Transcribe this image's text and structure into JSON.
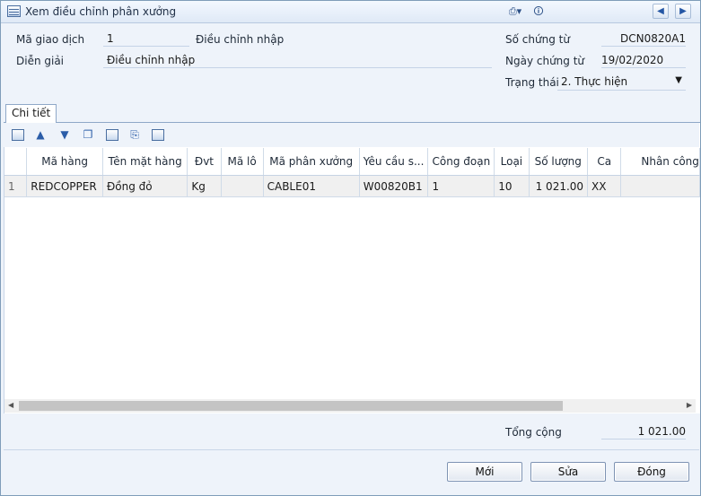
{
  "window": {
    "title": "Xem điều chỉnh phân xưởng"
  },
  "titlebar": {
    "print_glyph": "⎙▾",
    "info_glyph": "🛈",
    "prev_glyph": "◆",
    "next_glyph": "◆"
  },
  "form": {
    "ma_giao_dich_label": "Mã giao dịch",
    "ma_giao_dich_value": "1",
    "loai_value": "Điều chỉnh nhập",
    "dien_giai_label": "Diễn giải",
    "dien_giai_value": "Điều chỉnh nhập",
    "so_chung_tu_label": "Số chứng từ",
    "so_chung_tu_value": "DCN0820A1",
    "ngay_chung_tu_label": "Ngày chứng từ",
    "ngay_chung_tu_value": "19/02/2020",
    "trang_thai_label": "Trạng thái",
    "trang_thai_value": "2. Thực hiện"
  },
  "tabs": [
    {
      "label": "Chi tiết"
    }
  ],
  "grid": {
    "columns": [
      "",
      "Mã hàng",
      "Tên mặt hàng",
      "Đvt",
      "Mã lô",
      "Mã phân xưởng",
      "Yêu cầu s...",
      "Công đoạn",
      "Loại",
      "Số lượng",
      "Ca",
      "Nhân công"
    ],
    "rows": [
      [
        "1",
        "REDCOPPER",
        "Đồng đỏ",
        "Kg",
        "",
        "CABLE01",
        "W00820B1",
        "1",
        "10",
        "1 021.00",
        "XX",
        ""
      ]
    ]
  },
  "totals": {
    "label": "Tổng cộng",
    "value": "1 021.00"
  },
  "buttons": {
    "new": "Mới",
    "edit": "Sửa",
    "close": "Đóng"
  },
  "colors": {
    "background": "#eef3fa",
    "border": "#7f9db9",
    "selected_row": "#f0f0f0"
  }
}
